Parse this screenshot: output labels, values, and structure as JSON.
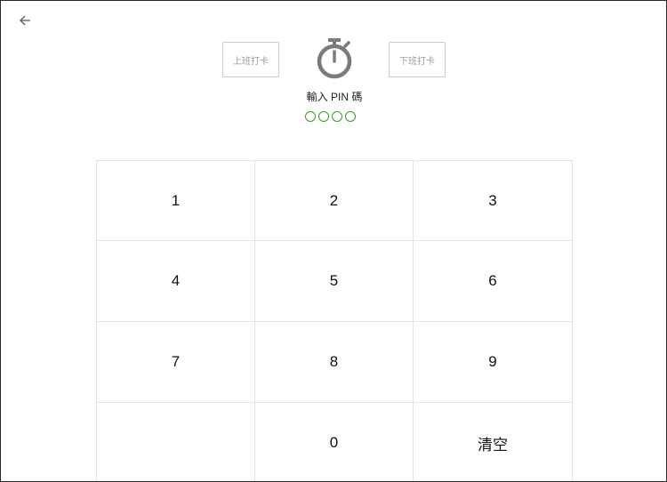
{
  "header": {
    "back_icon": "arrow-left-icon",
    "clock_in_label": "上班打卡",
    "clock_out_label": "下班打卡",
    "timer_icon": "stopwatch-icon"
  },
  "pin": {
    "label": "輸入 PIN 碼",
    "digits_entered": 0,
    "digits_total": 4,
    "dot_color": "#3a9a28"
  },
  "keypad": {
    "keys": [
      "1",
      "2",
      "3",
      "4",
      "5",
      "6",
      "7",
      "8",
      "9",
      "",
      "0",
      "清空"
    ]
  }
}
